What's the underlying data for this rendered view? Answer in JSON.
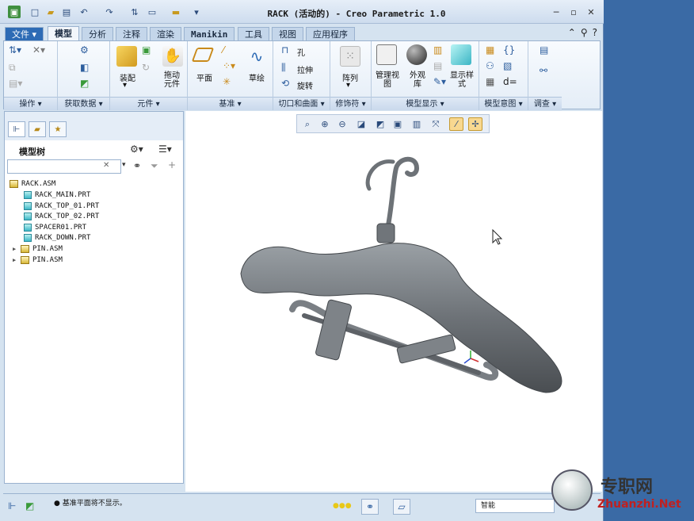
{
  "window": {
    "title": "RACK (活动的) - Creo Parametric 1.0"
  },
  "tabs": [
    {
      "label": "文件",
      "arrow": "▾"
    },
    {
      "label": "模型"
    },
    {
      "label": "分析"
    },
    {
      "label": "注释"
    },
    {
      "label": "渲染"
    },
    {
      "label": "Manikin"
    },
    {
      "label": "工具"
    },
    {
      "label": "视图"
    },
    {
      "label": "应用程序"
    }
  ],
  "ribbon": {
    "groups": [
      {
        "label": "操作 ▾"
      },
      {
        "label": "获取数据 ▾"
      },
      {
        "label": "元件 ▾"
      },
      {
        "label": "基准 ▾"
      },
      {
        "label": "切口和曲面 ▾"
      },
      {
        "label": "修饰符 ▾"
      },
      {
        "label": "模型显示 ▾"
      },
      {
        "label": "模型意图 ▾"
      },
      {
        "label": "调查 ▾"
      }
    ],
    "buttons": {
      "assemble": "装配",
      "drag": "拖动\n元件",
      "plane": "平面",
      "sketch": "草绘",
      "hole": "孔",
      "extrude": "拉伸",
      "revolve": "旋转",
      "pattern": "阵列",
      "manage_views": "管理视\n图",
      "appearance": "外观\n库",
      "display_style": "显示样\n式"
    }
  },
  "model_tree": {
    "title": "模型树",
    "search_value": "",
    "items": [
      {
        "name": "RACK.ASM",
        "type": "asm",
        "level": 0
      },
      {
        "name": "RACK_MAIN.PRT",
        "type": "prt",
        "level": 1
      },
      {
        "name": "RACK_TOP_01.PRT",
        "type": "prt",
        "level": 1
      },
      {
        "name": "RACK_TOP_02.PRT",
        "type": "prt",
        "level": 1
      },
      {
        "name": "SPACER01.PRT",
        "type": "prt",
        "level": 1
      },
      {
        "name": "RACK_DOWN.PRT",
        "type": "prt",
        "level": 1
      },
      {
        "name": "PIN.ASM",
        "type": "asm",
        "level": 1,
        "expandable": true
      },
      {
        "name": "PIN.ASM",
        "type": "asm",
        "level": 1,
        "expandable": true
      }
    ]
  },
  "status": {
    "message": "基准平面将不显示。",
    "filter": "智能"
  },
  "watermark": {
    "cn": "专职网",
    "url": "Zhuanzhi.Net"
  },
  "colors": {
    "file_tab": "#2d6bb5",
    "ribbon_bg": "#e4edf7",
    "model_gray": "#6d7277"
  }
}
